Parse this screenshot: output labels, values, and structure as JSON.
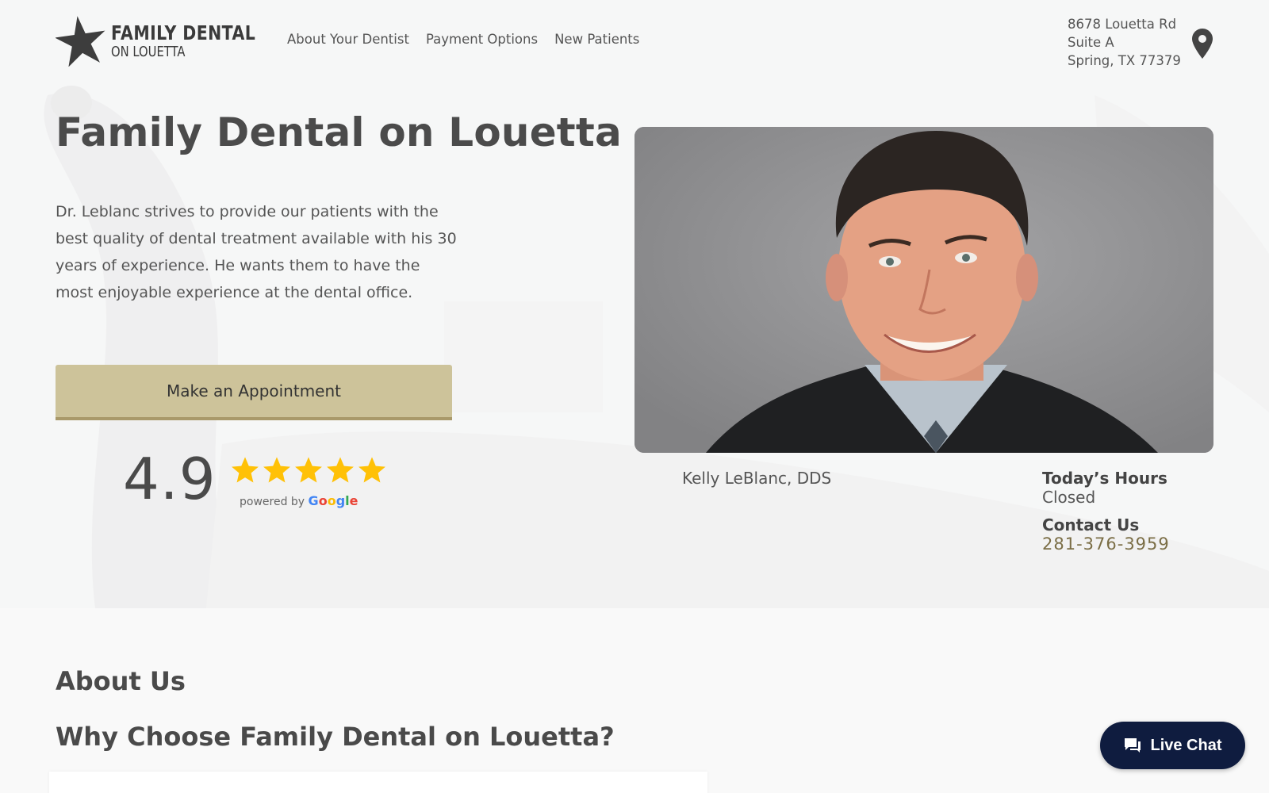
{
  "brand": {
    "line1": "FAMILY DENTAL",
    "line2": "ON LOUETTA"
  },
  "nav": {
    "items": [
      {
        "label": "About Your Dentist"
      },
      {
        "label": "Payment Options"
      },
      {
        "label": "New Patients"
      }
    ]
  },
  "address": {
    "line1": "8678 Louetta Rd",
    "line2": "Suite A",
    "line3": "Spring, TX 77379"
  },
  "hero": {
    "title": "Family Dental on Louetta",
    "intro": "Dr. Leblanc strives to provide our patients with the best quality of dental treatment available with his 30 years of experience. He wants them to have the most enjoyable experience at the dental office.",
    "cta_label": "Make an Appointment"
  },
  "rating": {
    "value": "4.9",
    "stars": 5,
    "powered_by": "powered by",
    "google": [
      "G",
      "o",
      "o",
      "g",
      "l",
      "e"
    ]
  },
  "dentist": {
    "caption": "Kelly LeBlanc, DDS"
  },
  "info": {
    "hours_label": "Today’s Hours",
    "hours_value": "Closed",
    "contact_label": "Contact Us",
    "phone": "281-376-3959"
  },
  "about": {
    "heading": "About Us",
    "subheading": "Why Choose Family Dental on Louetta?"
  },
  "chat": {
    "label": "Live Chat"
  },
  "colors": {
    "cta_bg": "#cdc39a",
    "cta_border": "#a9996a",
    "star": "#FFC107",
    "phone": "#7b6e46",
    "chat_bg": "#0f1c3f"
  }
}
